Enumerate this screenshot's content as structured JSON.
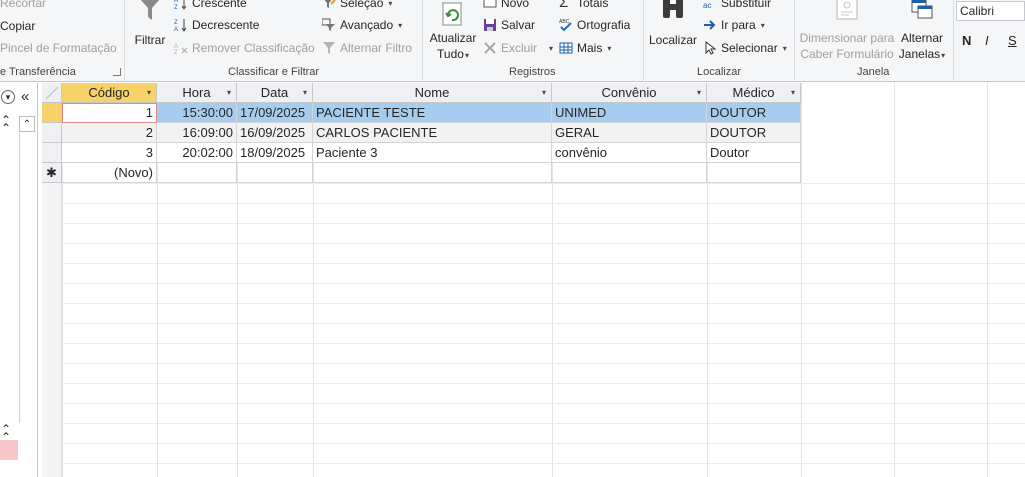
{
  "ribbon": {
    "clipboard": {
      "cut_label": "Recortar",
      "copy_label": "Copiar",
      "format_painter_label": "Pincel de Formatação",
      "group_label": "e Transferência"
    },
    "sort_filter": {
      "filter_label": "Filtrar",
      "ascending_label": "Crescente",
      "descending_label": "Decrescente",
      "remove_sort_label": "Remover Classificação",
      "selection_label": "Seleção",
      "advanced_label": "Avançado",
      "toggle_filter_label": "Alternar Filtro",
      "group_label": "Classificar e Filtrar"
    },
    "records": {
      "refresh_label_1": "Atualizar",
      "refresh_label_2": "Tudo",
      "new_label": "Novo",
      "save_label": "Salvar",
      "delete_label": "Excluir",
      "totals_label": "Totais",
      "spelling_label": "Ortografia",
      "more_label": "Mais",
      "group_label": "Registros"
    },
    "find": {
      "find_label": "Localizar",
      "replace_label": "Substituir",
      "goto_label": "Ir para",
      "select_label": "Selecionar",
      "group_label": "Localizar"
    },
    "window": {
      "size_to_fit_1": "Dimensionar para",
      "size_to_fit_2": "Caber Formulário",
      "switch_windows_1": "Alternar",
      "switch_windows_2": "Janelas",
      "group_label": "Janela"
    },
    "text": {
      "font_name": "Calibri",
      "bold_label": "N",
      "italic_label": "I",
      "underline_label": "S"
    }
  },
  "nav": {
    "menu_glyph": "▾",
    "collapse_glyph": "«",
    "up_glyph": "⌃",
    "section_up_glyph": "⌃"
  },
  "table": {
    "columns": [
      "Código",
      "Hora",
      "Data",
      "Nome",
      "Convênio",
      "Médico"
    ],
    "rows": [
      {
        "codigo": "1",
        "hora": "15:30:00",
        "data": "17/09/2025",
        "nome": "PACIENTE TESTE",
        "convenio": "UNIMED",
        "medico": "DOUTOR"
      },
      {
        "codigo": "2",
        "hora": "16:09:00",
        "data": "16/09/2025",
        "nome": "CARLOS PACIENTE",
        "convenio": "GERAL",
        "medico": "DOUTOR"
      },
      {
        "codigo": "3",
        "hora": "20:02:00",
        "data": "18/09/2025",
        "nome": "Paciente 3",
        "convenio": "convênio",
        "medico": "Doutor"
      }
    ],
    "new_row_label": "(Novo)",
    "new_row_marker": "✱",
    "colors": {
      "selected_row": "#a6cdf0",
      "active_header": "#f7d268"
    }
  }
}
